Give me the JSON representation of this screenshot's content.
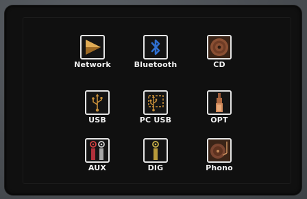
{
  "sources": [
    {
      "label": "Network",
      "icon": "network-icon"
    },
    {
      "label": "Bluetooth",
      "icon": "bluetooth-icon"
    },
    {
      "label": "CD",
      "icon": "cd-icon"
    },
    {
      "label": "USB",
      "icon": "usb-icon"
    },
    {
      "label": "PC USB",
      "icon": "pc-usb-icon"
    },
    {
      "label": "OPT",
      "icon": "optical-icon"
    },
    {
      "label": "AUX",
      "icon": "aux-rca-icon"
    },
    {
      "label": "DIG",
      "icon": "digital-coax-icon"
    },
    {
      "label": "Phono",
      "icon": "turntable-icon"
    }
  ],
  "colors": {
    "accent_gold": "#c9903a",
    "bluetooth_blue": "#2f6fd0",
    "tile_border": "#e6e6e6",
    "screen_bg": "#101010"
  }
}
